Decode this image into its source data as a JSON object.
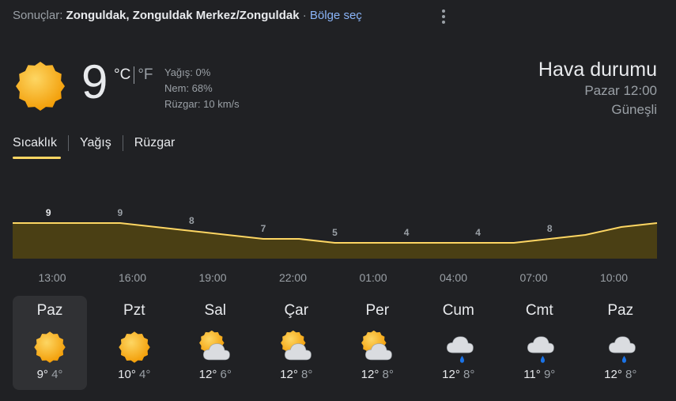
{
  "search": {
    "results_label": "Sonuçlar:",
    "location": "Zonguldak, Zonguldak Merkez/Zonguldak",
    "separator": "·",
    "region_link": "Bölge seç"
  },
  "current": {
    "icon": "sun-icon",
    "temperature": "9",
    "unit_c": "°C",
    "unit_f": "°F",
    "precipitation": "Yağış: 0%",
    "humidity": "Nem: 68%",
    "wind": "Rüzgar: 10 km/s"
  },
  "header": {
    "title": "Hava durumu",
    "datetime": "Pazar 12:00",
    "condition": "Güneşli"
  },
  "tabs": [
    {
      "label": "Sıcaklık",
      "active": true
    },
    {
      "label": "Yağış",
      "active": false
    },
    {
      "label": "Rüzgar",
      "active": false
    }
  ],
  "colors": {
    "accent": "#fdd663",
    "area_fill": "#4a3f14",
    "background": "#202124",
    "selected_day": "#303134",
    "link": "#8ab4f8"
  },
  "chart_data": {
    "type": "area",
    "series": [
      {
        "values": [
          9,
          9,
          9,
          9,
          8,
          7,
          6,
          5,
          5,
          4,
          4,
          4,
          4,
          4,
          4,
          5,
          6,
          8,
          9
        ]
      }
    ],
    "labels": [
      "9",
      "9",
      "8",
      "7",
      "5",
      "4",
      "4",
      "8"
    ],
    "label_indices": [
      0,
      2,
      4,
      6,
      8,
      10,
      12,
      14,
      16,
      18
    ],
    "x_ticks": [
      "13:00",
      "16:00",
      "19:00",
      "22:00",
      "01:00",
      "04:00",
      "07:00",
      "10:00"
    ],
    "ylim": [
      0,
      12
    ]
  },
  "forecast": [
    {
      "day": "Paz",
      "icon": "sun-icon",
      "high": "9°",
      "low": "4°",
      "selected": true
    },
    {
      "day": "Pzt",
      "icon": "sun-icon",
      "high": "10°",
      "low": "4°"
    },
    {
      "day": "Sal",
      "icon": "partly-cloudy-icon",
      "high": "12°",
      "low": "6°"
    },
    {
      "day": "Çar",
      "icon": "partly-cloudy-icon",
      "high": "12°",
      "low": "8°"
    },
    {
      "day": "Per",
      "icon": "partly-cloudy-icon",
      "high": "12°",
      "low": "8°"
    },
    {
      "day": "Cum",
      "icon": "rain-cloud-icon",
      "high": "12°",
      "low": "8°"
    },
    {
      "day": "Cmt",
      "icon": "rain-cloud-icon",
      "high": "11°",
      "low": "9°"
    },
    {
      "day": "Paz",
      "icon": "rain-cloud-icon",
      "high": "12°",
      "low": "8°"
    }
  ]
}
